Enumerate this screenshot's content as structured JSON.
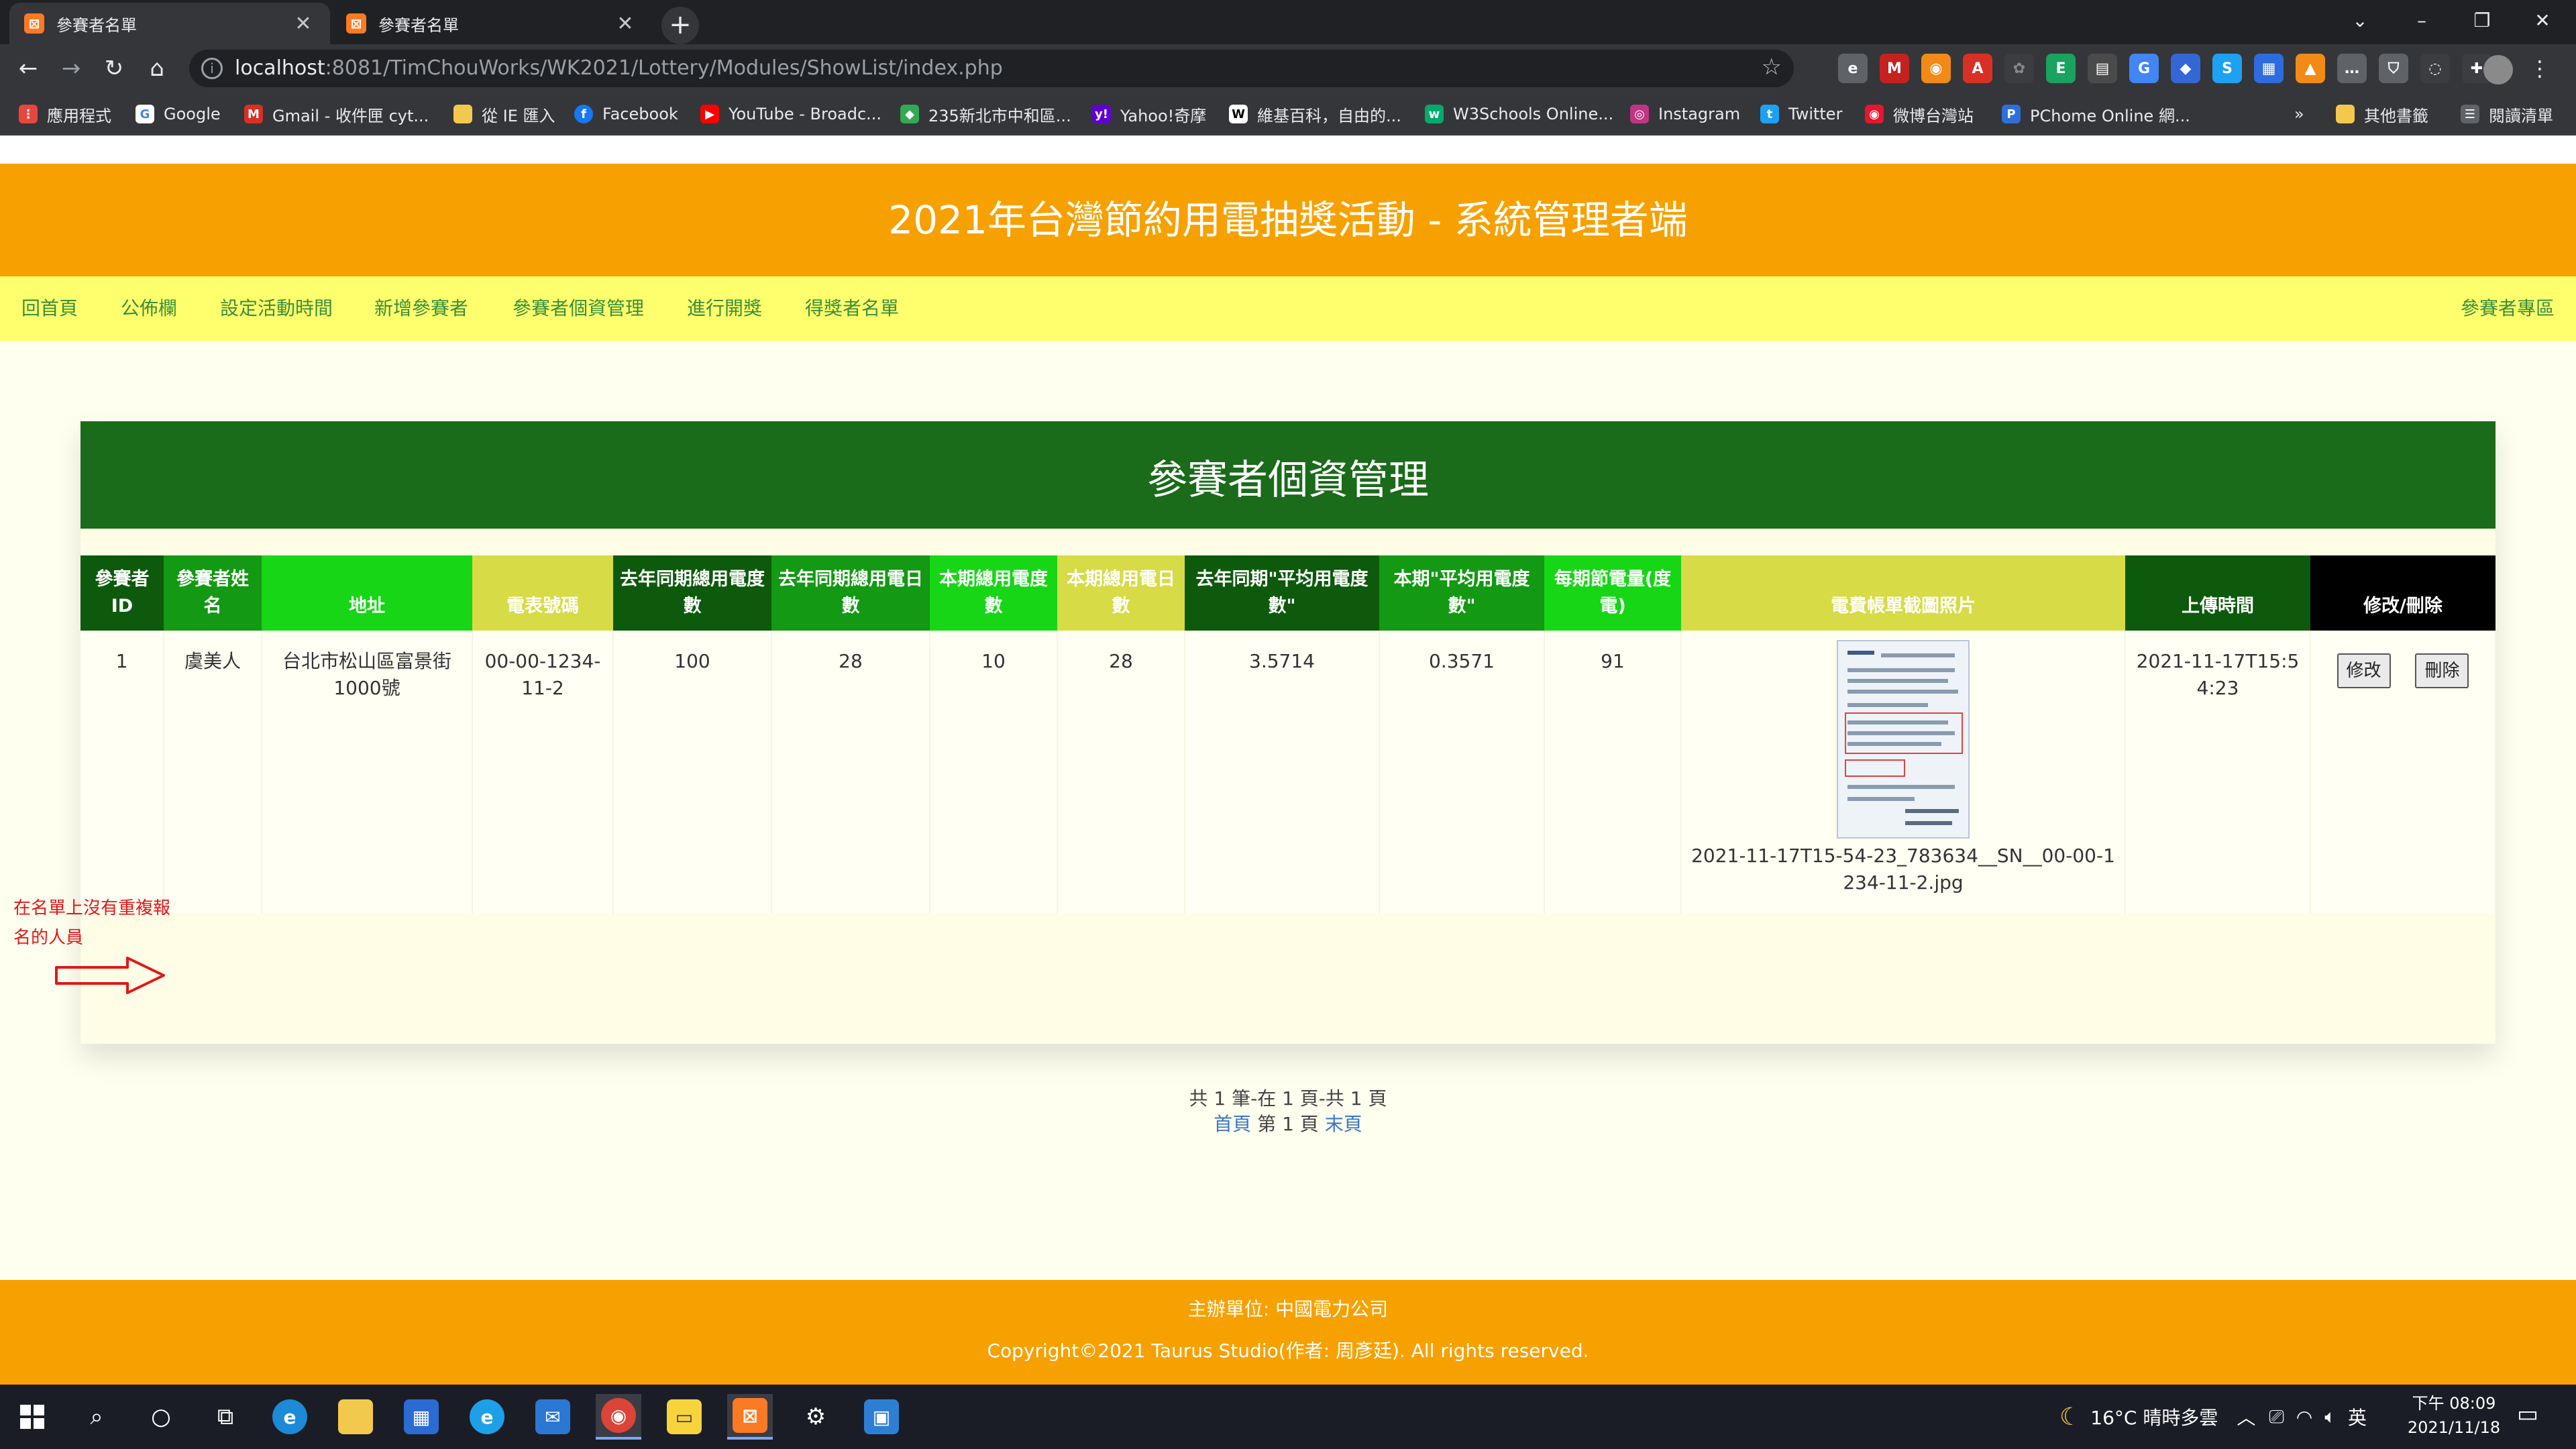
{
  "browser": {
    "tabs": [
      {
        "title": "參賽者名單",
        "icon": "xampp-icon"
      },
      {
        "title": "參賽者名單",
        "icon": "xampp-icon"
      }
    ],
    "new_tab": "+",
    "url_host": "localhost",
    "url_rest": ":8081/TimChouWorks/WK2021/Lottery/Modules/ShowList/index.php",
    "bookmarks": [
      {
        "label": "應用程式",
        "icon": "apps-grid-icon",
        "color": "#e8453c"
      },
      {
        "label": "Google",
        "icon": "google-icon",
        "color": "#4285f4"
      },
      {
        "label": "Gmail - 收件匣 cyt...",
        "icon": "gmail-icon",
        "color": "#d93025"
      },
      {
        "label": "從 IE 匯入",
        "icon": "folder-icon",
        "color": "#f2c94c"
      },
      {
        "label": "Facebook",
        "icon": "facebook-icon",
        "color": "#1877f2"
      },
      {
        "label": "YouTube - Broadc...",
        "icon": "youtube-icon",
        "color": "#ff0000"
      },
      {
        "label": "235新北市中和區...",
        "icon": "maps-icon",
        "color": "#34a853"
      },
      {
        "label": "Yahoo!奇摩",
        "icon": "yahoo-icon",
        "color": "#6001d2"
      },
      {
        "label": "維基百科，自由的...",
        "icon": "wikipedia-icon",
        "color": "#ffffff"
      },
      {
        "label": "W3Schools Online...",
        "icon": "w3schools-icon",
        "color": "#04aa6d"
      },
      {
        "label": "Instagram",
        "icon": "instagram-icon",
        "color": "#c13584"
      },
      {
        "label": "Twitter",
        "icon": "twitter-icon",
        "color": "#1da1f2"
      },
      {
        "label": "微博台灣站",
        "icon": "weibo-icon",
        "color": "#e6162d"
      },
      {
        "label": "PChome Online 網...",
        "icon": "pchome-icon",
        "color": "#2e6fd8"
      }
    ],
    "bookmarks_more": "»",
    "other_bookmarks": "其他書籤",
    "reading_list": "閱讀清單"
  },
  "site": {
    "title": "2021年台灣節約用電抽獎活動 - 系統管理者端",
    "menu": [
      "回首頁",
      "公佈欄",
      "設定活動時間",
      "新增參賽者",
      "參賽者個資管理",
      "進行開獎",
      "得獎者名單"
    ],
    "menu_right": "參賽者專區",
    "panel_title": "參賽者個資管理",
    "columns": [
      "參賽者ID",
      "參賽者姓名",
      "地址",
      "電表號碼",
      "去年同期總用電度數",
      "去年同期總用電日數",
      "本期總用電度數",
      "本期總用電日數",
      "去年同期\"平均用電度數\"",
      "本期\"平均用電度數\"",
      "每期節電量(度電)",
      "電費帳單截圖照片",
      "上傳時間",
      "修改/刪除"
    ],
    "rows": [
      {
        "id": "1",
        "name": "虞美人",
        "address": "台北市松山區富景街1000號",
        "meter": "00-00-1234-11-2",
        "last_kwh": "100",
        "last_days": "28",
        "cur_kwh": "10",
        "cur_days": "28",
        "last_avg": "3.5714",
        "cur_avg": "0.3571",
        "saving": "91",
        "photo_name": "2021-11-17T15-54-23_783634__SN__00-00-1234-11-2.jpg",
        "upload_time": "2021-11-17T15:54:23",
        "edit_label": "修改",
        "delete_label": "刪除"
      }
    ],
    "pager_summary": "共 1 筆-在 1 頁-共 1 頁",
    "pager_first": "首頁",
    "pager_current": "第 1 頁",
    "pager_last": "末頁",
    "annotation": "在名單上沒有重複報名的人員",
    "footer_org": "主辦單位: 中國電力公司",
    "footer_copyright": "Copyright©2021 Taurus Studio(作者: 周彥廷). All rights reserved."
  },
  "taskbar": {
    "weather": "16°C  晴時多雲",
    "ime": "英",
    "time": "下午 08:09",
    "date": "2021/11/18"
  },
  "colors": {
    "header_orange": "#f7a100",
    "menu_yellow": "#ffff6e",
    "panel_green": "#1a6b1a",
    "annotation_red": "#e01818"
  }
}
